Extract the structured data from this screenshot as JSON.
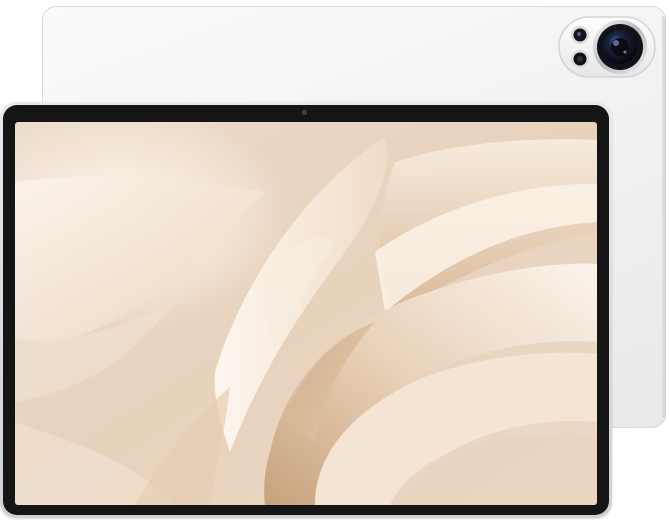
{
  "product": {
    "colors": {
      "body": "#f2f2f2",
      "frame": "#d6d7da",
      "bezel": "#151515",
      "wallpaper_base": "#e8d6c4",
      "wallpaper_highlight": "#fbf3ea",
      "wallpaper_shadow": "#b9946b"
    },
    "icons": [
      "rear-camera-icon",
      "flash-icon",
      "front-camera-icon"
    ]
  }
}
